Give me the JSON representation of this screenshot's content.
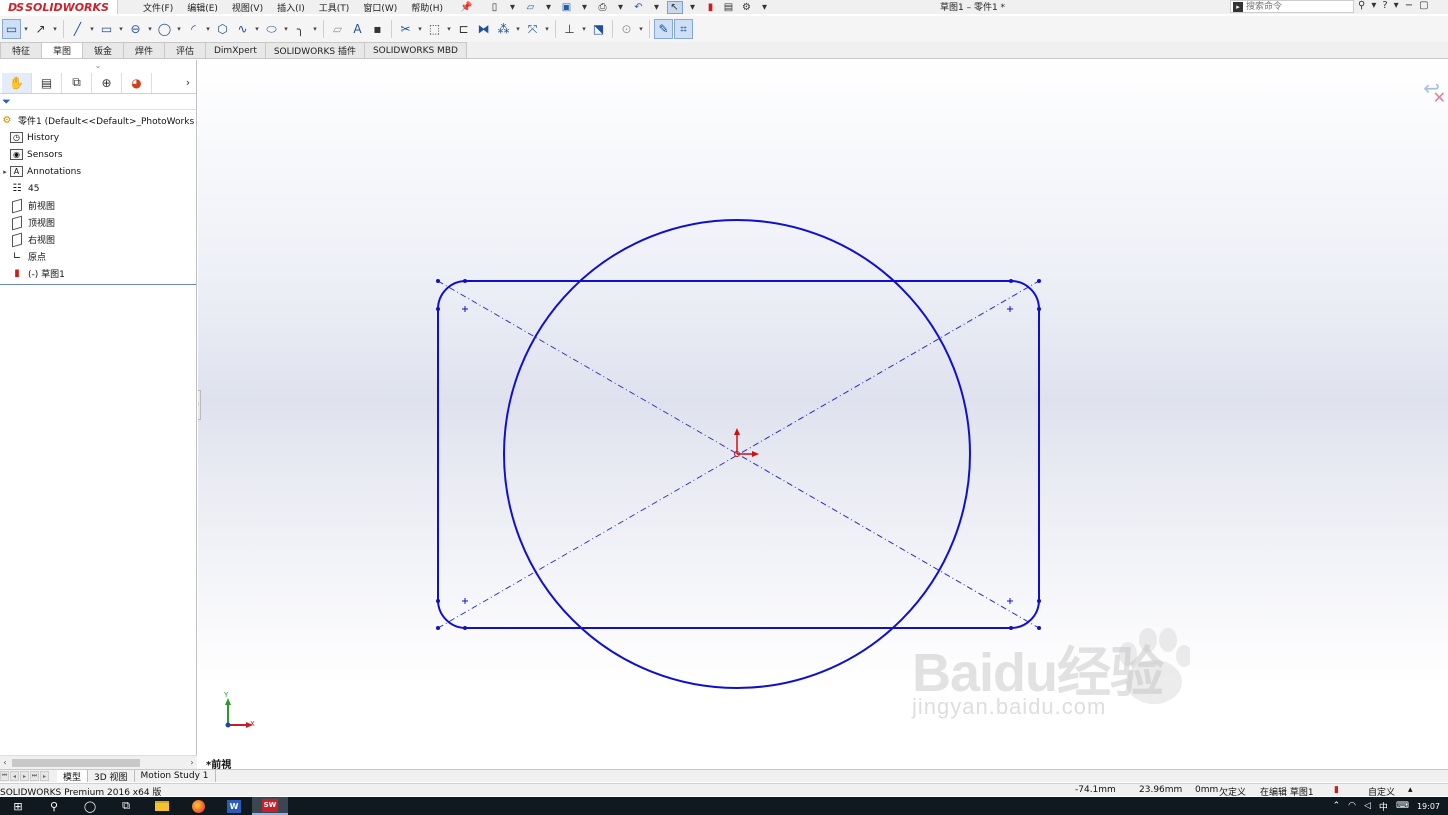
{
  "app": {
    "logo_ds": "DS",
    "logo_brand": "SOLIDWORKS",
    "document_title": "草图1 – 零件1 *",
    "menus": [
      "文件(F)",
      "编辑(E)",
      "视图(V)",
      "插入(I)",
      "工具(T)",
      "窗口(W)",
      "帮助(H)"
    ],
    "search_placeholder": "搜索命令"
  },
  "command_tabs": [
    "特征",
    "草图",
    "钣金",
    "焊件",
    "评估",
    "DimXpert",
    "SOLIDWORKS 插件",
    "SOLIDWORKS MBD"
  ],
  "active_command_tab": "草图",
  "feature_tree": {
    "root": "零件1  (Default<<Default>_PhotoWorks",
    "items": [
      {
        "label": "History",
        "icon": "history-icon"
      },
      {
        "label": "Sensors",
        "icon": "sensors-icon"
      },
      {
        "label": "Annotations",
        "icon": "annotations-icon"
      },
      {
        "label": "45",
        "icon": "material-icon"
      },
      {
        "label": "前视图",
        "icon": "plane-icon"
      },
      {
        "label": "顶视图",
        "icon": "plane-icon"
      },
      {
        "label": "右视图",
        "icon": "plane-icon"
      },
      {
        "label": "原点",
        "icon": "origin-icon"
      },
      {
        "label": "(-) 草图1",
        "icon": "sketch-icon"
      }
    ]
  },
  "viewport": {
    "view_label": "*前視",
    "triad_x": "X",
    "triad_y": "Y",
    "sketch_color": "#1010cc"
  },
  "watermark": {
    "line1": "Baidu经验",
    "line2": "jingyan.baidu.com"
  },
  "model_tabs": [
    "模型",
    "3D 视图",
    "Motion Study 1"
  ],
  "active_model_tab": "模型",
  "status": {
    "product": "SOLIDWORKS Premium 2016 x64 版",
    "x": "-74.1mm",
    "y": "23.96mm",
    "z": "0mm",
    "state": "欠定义",
    "mode": "在编辑 草图1",
    "custom": "自定义"
  },
  "taskbar": {
    "time": "19:07",
    "ime": "中"
  }
}
